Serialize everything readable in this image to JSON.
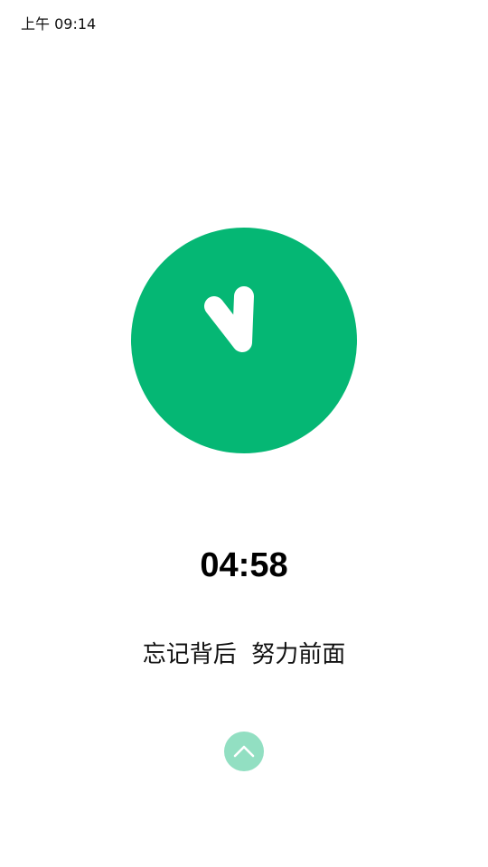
{
  "status_bar": {
    "time": "上午 09:14"
  },
  "logo": {
    "icon": "clock-check-icon",
    "color": "#05B774"
  },
  "timer": {
    "countdown": "04:58"
  },
  "motto": {
    "text": "忘记背后  努力前面"
  },
  "up_button": {
    "icon": "chevron-up-icon",
    "color": "#92DFC2"
  }
}
